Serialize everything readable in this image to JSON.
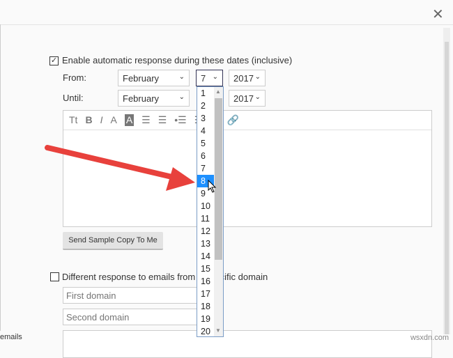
{
  "dialog": {
    "close_icon": "close-icon"
  },
  "auto_response": {
    "checked": true,
    "label": "Enable automatic response during these dates (inclusive)",
    "from_label": "From:",
    "until_label": "Until:",
    "from": {
      "month": "February",
      "day": "7",
      "year": "2017"
    },
    "until": {
      "month": "February",
      "year": "2017"
    }
  },
  "day_options": [
    "1",
    "2",
    "3",
    "4",
    "5",
    "6",
    "7",
    "8",
    "9",
    "10",
    "11",
    "12",
    "13",
    "14",
    "15",
    "16",
    "17",
    "18",
    "19",
    "20"
  ],
  "highlighted_day": "8",
  "toolbar": [
    "Tt",
    "B",
    "I",
    "A",
    "A",
    "☰",
    "☰",
    "•☰",
    "☰",
    "☰",
    "🔗"
  ],
  "send_sample_label": "Send Sample Copy To Me",
  "domain": {
    "checked": false,
    "label": "Different response to emails from a specific domain",
    "first_placeholder": "First domain",
    "second_placeholder": "Second domain"
  },
  "left_fragment": "emails",
  "watermark": "wsxdn.com",
  "colors": {
    "arrow": "#e8413c",
    "highlight": "#1e90ff"
  }
}
